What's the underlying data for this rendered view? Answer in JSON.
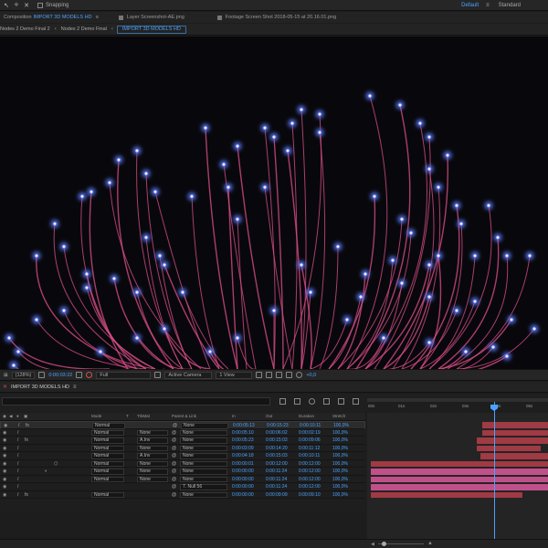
{
  "toolbar": {
    "snapping_label": "Snapping",
    "workspaces": [
      "Default",
      "Standard"
    ],
    "active_workspace": "Default"
  },
  "panel_tabs": [
    {
      "prefix": "Composition",
      "name": "IMPORT 3D MODELS HD"
    },
    {
      "prefix": "",
      "name": "Layer Screenshot-AE.png"
    },
    {
      "prefix": "",
      "name": "Footage Screen Shot 2018-05-15 at 20.16.01.png"
    }
  ],
  "breadcrumbs": [
    "Nodes 2 Demo Final 2",
    "Nodes 2 Demo Final",
    "IMPORT 3D MODELS HD"
  ],
  "viewer_bar": {
    "zoom": "(128%)",
    "timecode": "0:00:03:22",
    "resolution": "Full",
    "camera": "Active Camera",
    "views": "1 View",
    "exposure": "+0,0"
  },
  "timeline": {
    "comp_tab": "IMPORT 3D MODELS HD",
    "columns": {
      "mode": "Mode",
      "t": "T",
      "trkmat": "TrkMat",
      "parent": "Parent & Link",
      "in": "In",
      "out": "Out",
      "duration": "Duration",
      "stretch": "Stretch"
    },
    "ruler_ticks": [
      "00s",
      "01s",
      "02s",
      "03s",
      "04s",
      "05s"
    ],
    "layers": [
      {
        "mode": "Normal",
        "trkmat": "",
        "parent": "None",
        "in": "0:00:05:13",
        "out": "0:00:15:23",
        "duration": "0:00:10:11",
        "stretch": "100,0%"
      },
      {
        "mode": "Normal",
        "trkmat": "None",
        "parent": "None",
        "in": "0:00:05:10",
        "out": "0:00:06:02",
        "duration": "0:00:02:19",
        "stretch": "100,0%"
      },
      {
        "mode": "Normal",
        "trkmat": "A.Inv",
        "parent": "None",
        "in": "0:00:05:23",
        "out": "0:00:15:03",
        "duration": "0:00:09:06",
        "stretch": "100,0%"
      },
      {
        "mode": "Normal",
        "trkmat": "None",
        "parent": "None",
        "in": "0:00:03:09",
        "out": "0:00:14:20",
        "duration": "0:00:11:12",
        "stretch": "100,0%"
      },
      {
        "mode": "Normal",
        "trkmat": "A.Inv",
        "parent": "None",
        "in": "0:00:04:18",
        "out": "0:00:15:03",
        "duration": "0:00:10:11",
        "stretch": "100,0%"
      },
      {
        "mode": "Normal",
        "trkmat": "None",
        "parent": "None",
        "in": "0:00:00:01",
        "out": "0:00:12:00",
        "duration": "0:00:12:00",
        "stretch": "100,0%"
      },
      {
        "mode": "Normal",
        "trkmat": "None",
        "parent": "None",
        "in": "0:00:00:00",
        "out": "0:00:11:24",
        "duration": "0:00:12:00",
        "stretch": "100,0%"
      },
      {
        "mode": "Normal",
        "trkmat": "None",
        "parent": "None",
        "in": "0:00:00:00",
        "out": "0:00:11:24",
        "duration": "0:00:12:00",
        "stretch": "100,0%"
      },
      {
        "mode": "",
        "trkmat": "",
        "parent": "7. Null 56",
        "in": "0:00:00:00",
        "out": "0:00:11:24",
        "duration": "0:00:12:00",
        "stretch": "100,0%"
      },
      {
        "mode": "Normal",
        "trkmat": "",
        "parent": "None",
        "in": "0:00:00:00",
        "out": "0:00:09:09",
        "duration": "0:00:09:10",
        "stretch": "100,0%"
      }
    ]
  },
  "colors": {
    "accent": "#4aa3ff",
    "track_red": "#a03a44",
    "track_pink": "#c0508a",
    "strand_pink": "#e0508c",
    "strand_blue": "#5a78ff"
  },
  "icons": [
    "selection-tool-icon",
    "anchor-tool-icon",
    "pen-tool-icon",
    "snapshot-icon",
    "color-icon",
    "eye-icon",
    "audio-icon",
    "solo-icon",
    "lock-icon"
  ]
}
